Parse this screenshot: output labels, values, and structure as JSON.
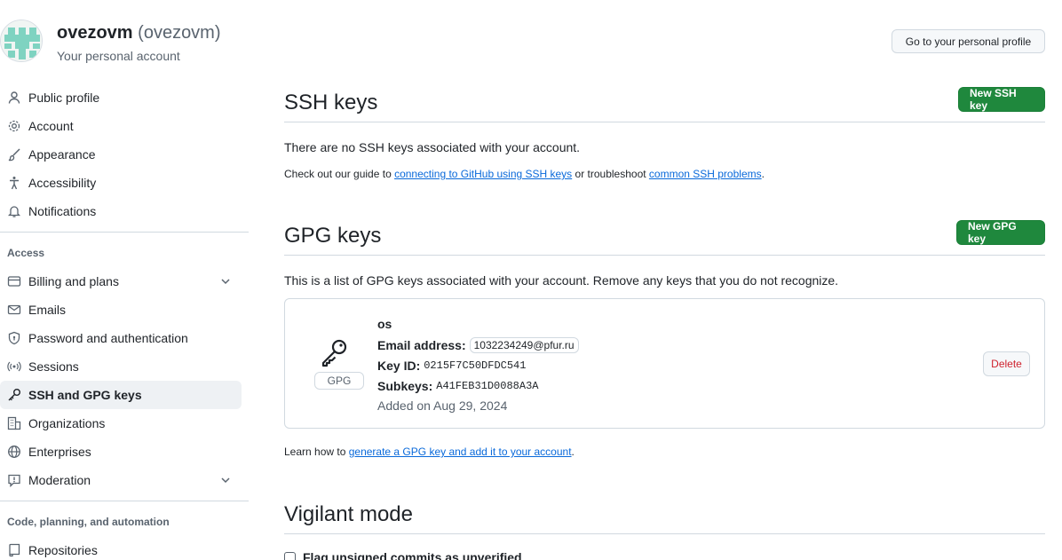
{
  "user": {
    "display_name": "ovezovm",
    "login": "(ovezovm)",
    "subtitle": "Your personal account",
    "profile_button": "Go to your personal profile"
  },
  "sidebar": {
    "top_items": [
      {
        "label": "Public profile",
        "icon": "person-icon"
      },
      {
        "label": "Account",
        "icon": "gear-icon"
      },
      {
        "label": "Appearance",
        "icon": "paintbrush-icon"
      },
      {
        "label": "Accessibility",
        "icon": "accessibility-icon"
      },
      {
        "label": "Notifications",
        "icon": "bell-icon"
      }
    ],
    "access_label": "Access",
    "access_items": [
      {
        "label": "Billing and plans",
        "icon": "credit-card-icon",
        "expandable": true
      },
      {
        "label": "Emails",
        "icon": "mail-icon"
      },
      {
        "label": "Password and authentication",
        "icon": "shield-lock-icon"
      },
      {
        "label": "Sessions",
        "icon": "broadcast-icon"
      },
      {
        "label": "SSH and GPG keys",
        "icon": "key-icon",
        "active": true
      },
      {
        "label": "Organizations",
        "icon": "organization-icon"
      },
      {
        "label": "Enterprises",
        "icon": "globe-icon"
      },
      {
        "label": "Moderation",
        "icon": "report-icon",
        "expandable": true
      }
    ],
    "code_label": "Code, planning, and automation",
    "code_items": [
      {
        "label": "Repositories",
        "icon": "repo-icon"
      }
    ]
  },
  "ssh": {
    "title": "SSH keys",
    "new_button": "New SSH key",
    "empty_text": "There are no SSH keys associated with your account.",
    "guide_prefix": "Check out our guide to ",
    "guide_link": "connecting to GitHub using SSH keys",
    "guide_middle": " or troubleshoot ",
    "guide_link2": "common SSH problems",
    "guide_suffix": "."
  },
  "gpg": {
    "title": "GPG keys",
    "new_button": "New GPG key",
    "intro": "This is a list of GPG keys associated with your account. Remove any keys that you do not recognize.",
    "key": {
      "name": "os",
      "badge": "GPG",
      "email_label": "Email address:",
      "email": "1032234249@pfur.ru",
      "keyid_label": "Key ID:",
      "keyid": "0215F7C50DFDC541",
      "subkeys_label": "Subkeys:",
      "subkeys": "A41FEB31D0088A3A",
      "added": "Added on Aug 29, 2024",
      "delete_button": "Delete"
    },
    "learn_prefix": "Learn how to ",
    "learn_link": "generate a GPG key and add it to your account",
    "learn_suffix": "."
  },
  "vigilant": {
    "title": "Vigilant mode",
    "checkbox_label": "Flag unsigned commits as unverified"
  },
  "colors": {
    "primary_green": "#1f883d",
    "link_blue": "#0969da",
    "danger_red": "#cf222e",
    "avatar_teal": "#7fd3c1"
  }
}
